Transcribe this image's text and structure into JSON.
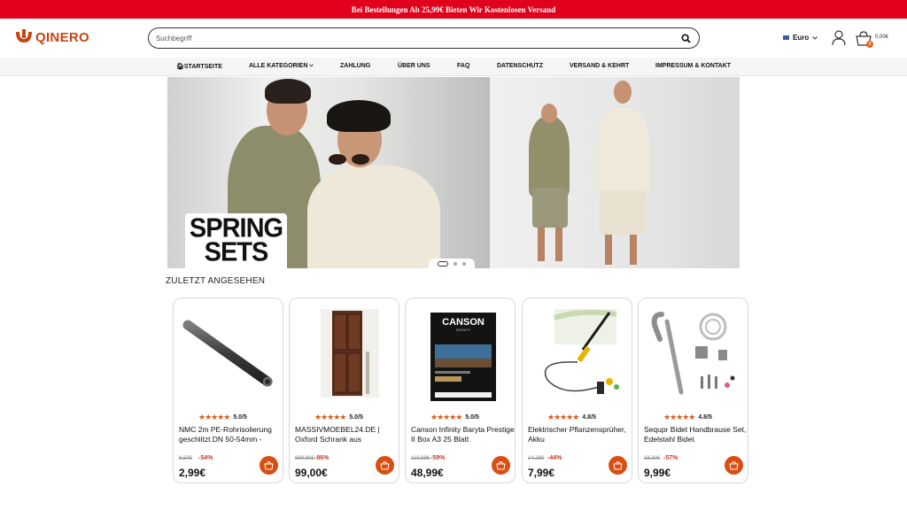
{
  "topbar": {
    "text": "Bei Bestellungen Ab 25,99€ Bieten Wir Kostenlosen Versand"
  },
  "brand": {
    "name": "QINERO",
    "color": "#c84614"
  },
  "search": {
    "placeholder": "Suchbegriff"
  },
  "currency": {
    "label": "Euro"
  },
  "cart": {
    "count": "0",
    "total": "0,00€"
  },
  "nav": [
    {
      "label": "STARTSEITE",
      "icon": "home-icon"
    },
    {
      "label": "ALLE KATEGORIEN",
      "icon": "chevron-down-icon"
    },
    {
      "label": "ZAHLUNG"
    },
    {
      "label": "ÜBER UNS"
    },
    {
      "label": "FAQ"
    },
    {
      "label": "DATENSCHUTZ"
    },
    {
      "label": "VERSAND & KEHRT"
    },
    {
      "label": "IMPRESSUM & KONTAKT"
    }
  ],
  "hero": {
    "line1": "SPRING",
    "line2": "SETS",
    "slides": 3,
    "active_slide": 1
  },
  "recent": {
    "title": "ZULETZT ANGESEHEN",
    "products": [
      {
        "name": "NMC 2m PE-Rohrisolierung geschlitzt DN 50-54mm -",
        "rating": "5.0/5",
        "old_price": "6,50€",
        "discount": "-54%",
        "price": "2,99€",
        "image": "pipe-insulation"
      },
      {
        "name": "MASSIVMOEBEL24.DE | Oxford Schrank aus",
        "rating": "5.0/5",
        "old_price": "699,90€",
        "discount": "-86%",
        "price": "99,00€",
        "image": "wooden-cabinet"
      },
      {
        "name": "Canson Infinity Baryta Prestige II Box A3 25 Blatt",
        "rating": "5.0/5",
        "old_price": "119,89€",
        "discount": "-59%",
        "price": "48,99€",
        "image": "canson-box"
      },
      {
        "name": "Elektrischer Pflanzensprüher, Akku",
        "rating": "4.8/5",
        "old_price": "14,28€",
        "discount": "-44%",
        "price": "7,99€",
        "image": "plant-sprayer"
      },
      {
        "name": "Sequpr Bidet Handbrause Set, Edelstahl Bidet",
        "rating": "4.8/5",
        "old_price": "23,30€",
        "discount": "-57%",
        "price": "9,99€",
        "image": "bidet-set"
      }
    ],
    "stars": "★★★★★"
  },
  "colors": {
    "topbar": "#e0001b",
    "accent": "#d94e12",
    "discount": "#d4331a"
  }
}
